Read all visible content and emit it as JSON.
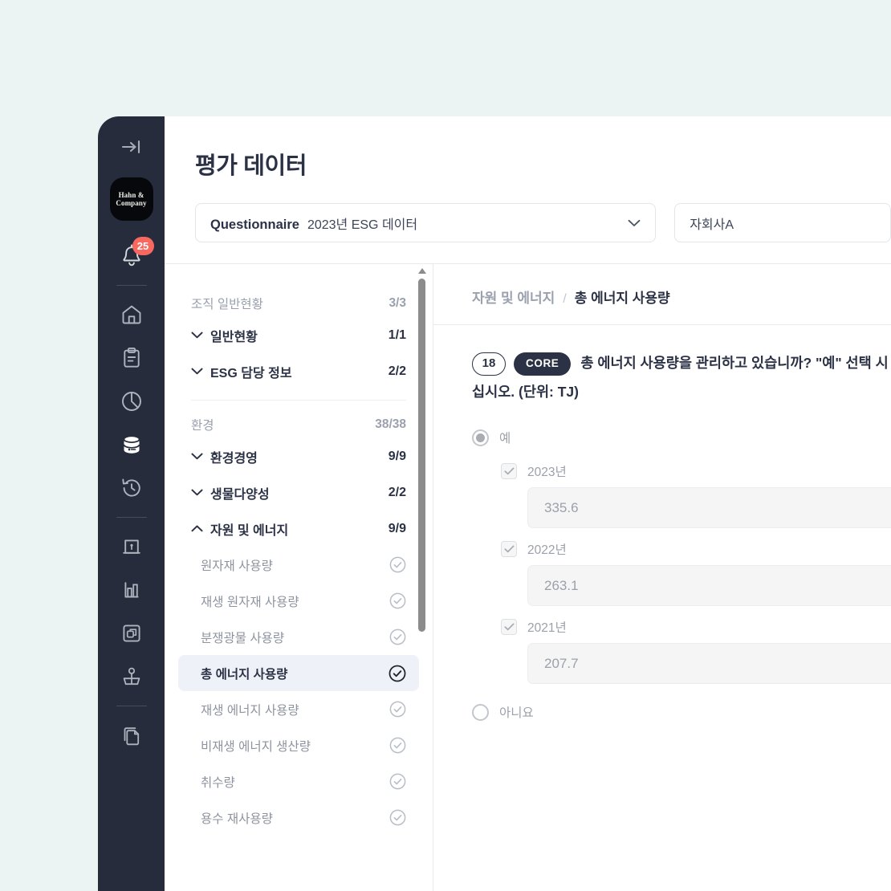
{
  "page": {
    "title": "평가 데이터"
  },
  "sidebar": {
    "collapse_icon": "collapse-arrow-icon",
    "logo_line1": "Hahn &",
    "logo_line2": "Company",
    "notification_count": "25",
    "icons": [
      {
        "name": "bell-icon"
      },
      {
        "name": "home-icon"
      },
      {
        "name": "clipboard-icon"
      },
      {
        "name": "pie-chart-icon"
      },
      {
        "name": "database-icon"
      },
      {
        "name": "history-icon"
      },
      {
        "name": "bank-icon"
      },
      {
        "name": "bar-chart-icon"
      },
      {
        "name": "layers-box-icon"
      },
      {
        "name": "podium-icon"
      },
      {
        "name": "documents-icon"
      }
    ]
  },
  "selectors": {
    "questionnaire_label": "Questionnaire",
    "questionnaire_value": "2023년 ESG 데이터",
    "company_value": "자회사A"
  },
  "tree": {
    "groups": [
      {
        "label": "조직 일반현황",
        "count": "3/3",
        "rows": [
          {
            "label": "일반현황",
            "count": "1/1",
            "expanded": false
          },
          {
            "label": "ESG 담당 정보",
            "count": "2/2",
            "expanded": false
          }
        ]
      },
      {
        "label": "환경",
        "count": "38/38",
        "rows": [
          {
            "label": "환경경영",
            "count": "9/9",
            "expanded": false
          },
          {
            "label": "생물다양성",
            "count": "2/2",
            "expanded": false
          },
          {
            "label": "자원 및 에너지",
            "count": "9/9",
            "expanded": true
          }
        ],
        "leaves": [
          {
            "label": "원자재 사용량",
            "selected": false
          },
          {
            "label": "재생 원자재 사용량",
            "selected": false
          },
          {
            "label": "분쟁광물 사용량",
            "selected": false
          },
          {
            "label": "총 에너지 사용량",
            "selected": true
          },
          {
            "label": "재생 에너지 사용량",
            "selected": false
          },
          {
            "label": "비재생 에너지 생산량",
            "selected": false
          },
          {
            "label": "취수량",
            "selected": false
          },
          {
            "label": "용수 재사용량",
            "selected": false
          }
        ]
      }
    ]
  },
  "question": {
    "breadcrumb_parent": "자원 및 에너지",
    "breadcrumb_sep": "/",
    "breadcrumb_current": "총 에너지 사용량",
    "number_badge": "18",
    "core_badge": "CORE",
    "text_line1": "총 에너지 사용량을 관리하고 있습니까? \"예\" 선택 시",
    "text_line2": "십시오. (단위: TJ)",
    "options": [
      {
        "label": "예",
        "selected": true
      },
      {
        "label": "아니요",
        "selected": false
      }
    ],
    "years": [
      {
        "label": "2023년",
        "checked": true,
        "value": "335.6"
      },
      {
        "label": "2022년",
        "checked": true,
        "value": "263.1"
      },
      {
        "label": "2021년",
        "checked": true,
        "value": "207.7"
      }
    ]
  },
  "colors": {
    "page_background": "#ecf4f3",
    "rail_background": "#272c3d",
    "accent_dark": "#2b3245",
    "badge_red": "#f8685f",
    "selected_row": "#eef2f8"
  }
}
